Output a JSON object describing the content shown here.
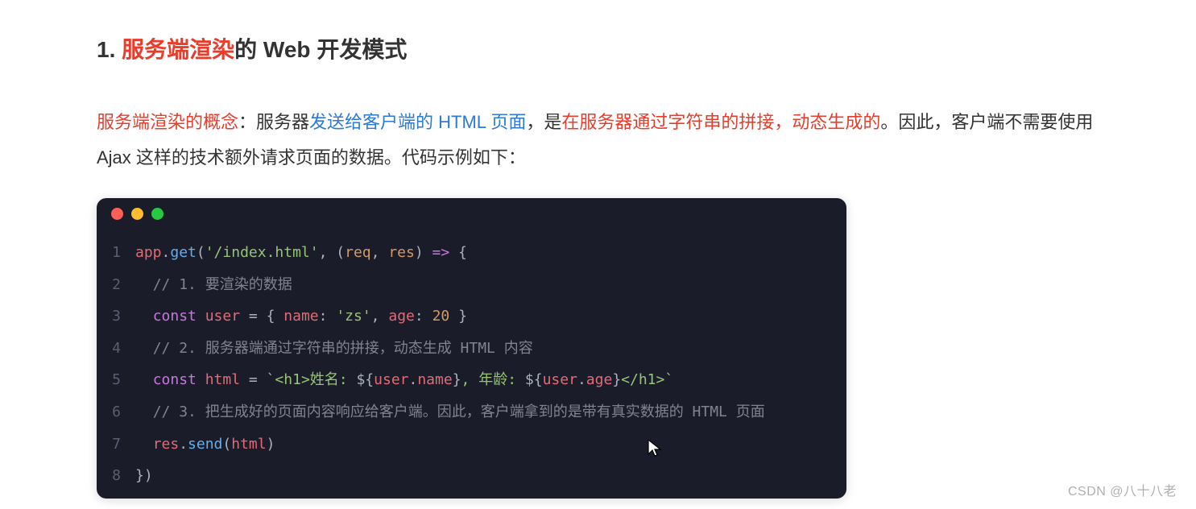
{
  "heading": {
    "prefix": "1. ",
    "highlight": "服务端渲染",
    "suffix": "的 Web 开发模式"
  },
  "paragraph": {
    "p1_red": "服务端渲染的概念",
    "p1_colon": "：服务器",
    "p1_blue": "发送给客户端的 HTML 页面",
    "p1_mid1": "，是",
    "p1_red2": "在服务器通过字符串的拼接，动态生成的",
    "p1_tail": "。因此，客户端不需要使用 Ajax 这样的技术额外请求页面的数据。代码示例如下："
  },
  "code": {
    "lines": [
      {
        "n": "1",
        "tokens": [
          {
            "c": "t-ident",
            "t": "app"
          },
          {
            "c": "t-punct",
            "t": "."
          },
          {
            "c": "t-method",
            "t": "get"
          },
          {
            "c": "t-punct",
            "t": "("
          },
          {
            "c": "t-string",
            "t": "'/index.html'"
          },
          {
            "c": "t-punct",
            "t": ", ("
          },
          {
            "c": "t-param",
            "t": "req"
          },
          {
            "c": "t-punct",
            "t": ", "
          },
          {
            "c": "t-param",
            "t": "res"
          },
          {
            "c": "t-punct",
            "t": ") "
          },
          {
            "c": "t-keyword",
            "t": "=>"
          },
          {
            "c": "t-punct",
            "t": " {"
          }
        ]
      },
      {
        "n": "2",
        "indent": "  ",
        "tokens": [
          {
            "c": "t-comment",
            "t": "// 1. 要渲染的数据"
          }
        ]
      },
      {
        "n": "3",
        "indent": "  ",
        "tokens": [
          {
            "c": "t-keyword",
            "t": "const"
          },
          {
            "c": "t-punct",
            "t": " "
          },
          {
            "c": "t-ident",
            "t": "user"
          },
          {
            "c": "t-punct",
            "t": " = { "
          },
          {
            "c": "t-prop",
            "t": "name"
          },
          {
            "c": "t-punct",
            "t": ": "
          },
          {
            "c": "t-string",
            "t": "'zs'"
          },
          {
            "c": "t-punct",
            "t": ", "
          },
          {
            "c": "t-prop",
            "t": "age"
          },
          {
            "c": "t-punct",
            "t": ": "
          },
          {
            "c": "t-number",
            "t": "20"
          },
          {
            "c": "t-punct",
            "t": " }"
          }
        ]
      },
      {
        "n": "4",
        "indent": "  ",
        "tokens": [
          {
            "c": "t-comment",
            "t": "// 2. 服务器端通过字符串的拼接，动态生成 HTML 内容"
          }
        ]
      },
      {
        "n": "5",
        "indent": "  ",
        "tokens": [
          {
            "c": "t-keyword",
            "t": "const"
          },
          {
            "c": "t-punct",
            "t": " "
          },
          {
            "c": "t-ident",
            "t": "html"
          },
          {
            "c": "t-punct",
            "t": " = "
          },
          {
            "c": "t-string",
            "t": "`<h1>姓名: "
          },
          {
            "c": "t-interp-brace",
            "t": "${"
          },
          {
            "c": "t-interp",
            "t": "user"
          },
          {
            "c": "t-punct",
            "t": "."
          },
          {
            "c": "t-interp",
            "t": "name"
          },
          {
            "c": "t-interp-brace",
            "t": "}"
          },
          {
            "c": "t-string",
            "t": ", 年龄: "
          },
          {
            "c": "t-interp-brace",
            "t": "${"
          },
          {
            "c": "t-interp",
            "t": "user"
          },
          {
            "c": "t-punct",
            "t": "."
          },
          {
            "c": "t-interp",
            "t": "age"
          },
          {
            "c": "t-interp-brace",
            "t": "}"
          },
          {
            "c": "t-string",
            "t": "</h1>`"
          }
        ]
      },
      {
        "n": "6",
        "indent": "  ",
        "tokens": [
          {
            "c": "t-comment",
            "t": "// 3. 把生成好的页面内容响应给客户端。因此，客户端拿到的是带有真实数据的 HTML 页面"
          }
        ]
      },
      {
        "n": "7",
        "indent": "  ",
        "tokens": [
          {
            "c": "t-ident",
            "t": "res"
          },
          {
            "c": "t-punct",
            "t": "."
          },
          {
            "c": "t-method",
            "t": "send"
          },
          {
            "c": "t-punct",
            "t": "("
          },
          {
            "c": "t-ident",
            "t": "html"
          },
          {
            "c": "t-punct",
            "t": ")"
          }
        ]
      },
      {
        "n": "8",
        "tokens": [
          {
            "c": "t-punct",
            "t": "})"
          }
        ]
      }
    ]
  },
  "watermark": "CSDN @八十八老"
}
